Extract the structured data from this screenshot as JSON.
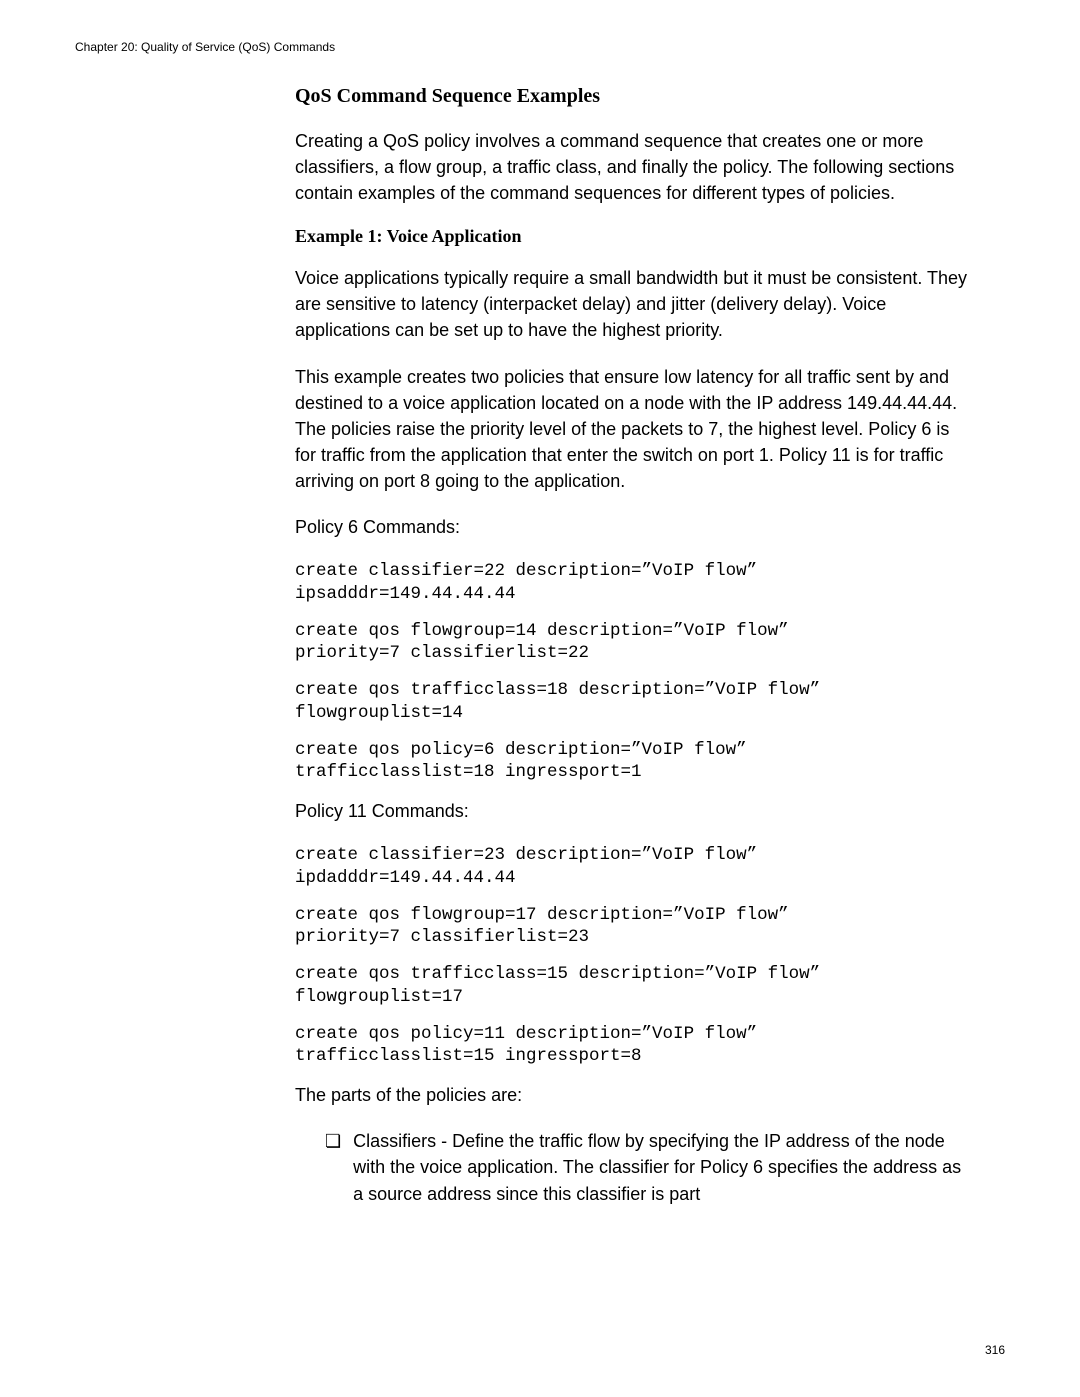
{
  "header": {
    "chapter_line": "Chapter 20: Quality of Service (QoS) Commands"
  },
  "content": {
    "section_title": "QoS Command Sequence Examples",
    "intro_para": "Creating a QoS policy involves a command sequence that creates one or more classifiers, a flow group, a traffic class, and finally the policy. The following sections contain examples of the command sequences for different types of policies.",
    "example1_title": "Example 1: Voice Application",
    "example1_para1": "Voice applications typically require a small bandwidth but it must be consistent. They are sensitive to latency (interpacket delay) and jitter (delivery delay). Voice applications can be set up to have the highest priority.",
    "example1_para2": "This example creates two policies that ensure low latency for all traffic sent by and destined to a voice application located on a node with the IP address 149.44.44.44. The policies raise the priority level of the packets to 7, the highest level. Policy 6 is for traffic from the application that enter the switch on port 1. Policy 11 is for traffic arriving on port 8 going to the application.",
    "policy6_label": "Policy 6 Commands:",
    "policy6_cmd1": "create classifier=22 description=”VoIP flow” \nipsadddr=149.44.44.44",
    "policy6_cmd2": "create qos flowgroup=14 description=”VoIP flow” \npriority=7 classifierlist=22",
    "policy6_cmd3": "create qos trafficclass=18 description=”VoIP flow” \nflowgrouplist=14",
    "policy6_cmd4": "create qos policy=6 description=”VoIP flow” \ntrafficclasslist=18 ingressport=1",
    "policy11_label": "Policy 11 Commands:",
    "policy11_cmd1": "create classifier=23 description=”VoIP flow” \nipdadddr=149.44.44.44",
    "policy11_cmd2": "create qos flowgroup=17 description=”VoIP flow” \npriority=7 classifierlist=23",
    "policy11_cmd3": "create qos trafficclass=15 description=”VoIP flow” \nflowgrouplist=17",
    "policy11_cmd4": "create qos policy=11 description=”VoIP flow” \ntrafficclasslist=15 ingressport=8",
    "parts_intro": "The parts of the policies are:",
    "bullet1": "Classifiers - Define the traffic flow by specifying the IP address of the node with the voice application. The classifier for Policy 6 specifies the address as a source address since this classifier is part"
  },
  "footer": {
    "page_number": "316"
  }
}
